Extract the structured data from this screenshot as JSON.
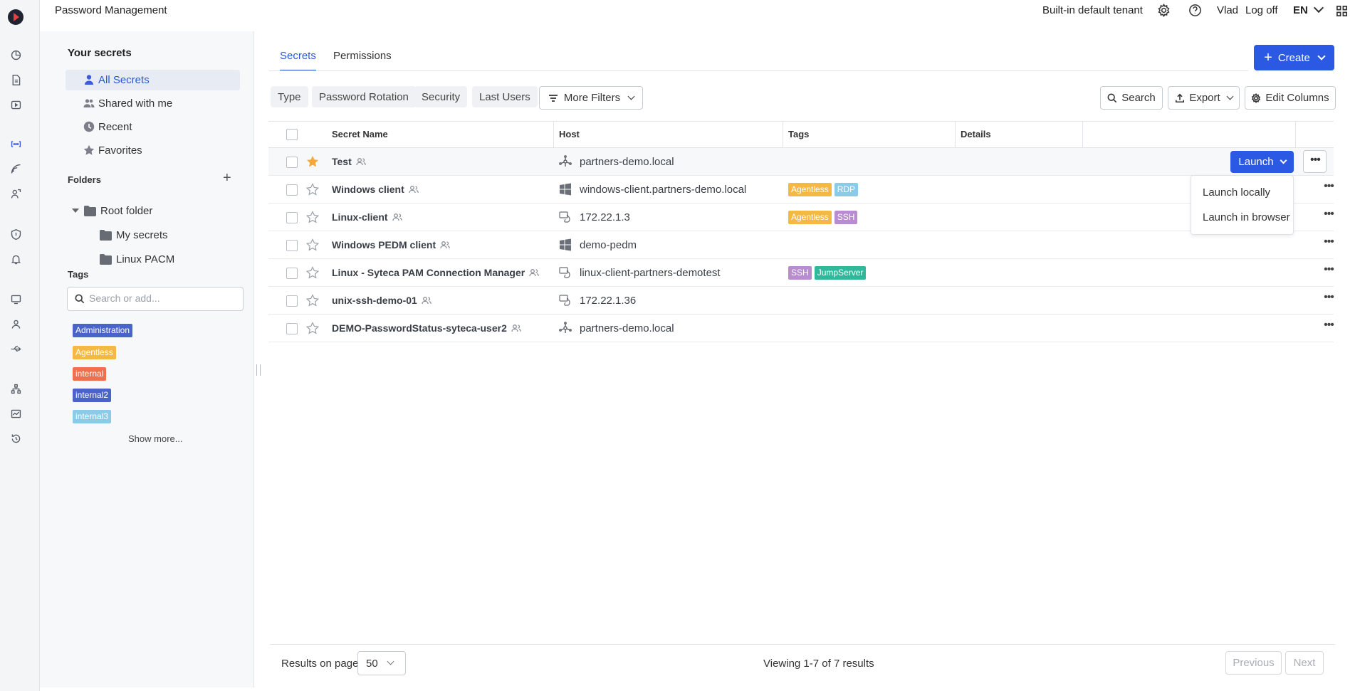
{
  "app": {
    "title": "Password Management"
  },
  "topbar": {
    "tenant": "Built-in default tenant",
    "user": "Vlad",
    "logoff": "Log off",
    "language": "EN"
  },
  "sidebar": {
    "section_title": "Your secrets",
    "items": [
      {
        "label": "All Secrets",
        "icon": "user-icon",
        "active": true
      },
      {
        "label": "Shared with me",
        "icon": "users-icon"
      },
      {
        "label": "Recent",
        "icon": "clock-icon"
      },
      {
        "label": "Favorites",
        "icon": "star-icon"
      }
    ],
    "folders_title": "Folders",
    "root_folder": "Root folder",
    "subfolders": [
      "My secrets",
      "Linux PACM"
    ],
    "tags_title": "Tags",
    "tags_search_placeholder": "Search or add...",
    "tags": [
      {
        "label": "Administration",
        "color": "#4a63c8"
      },
      {
        "label": "Agentless",
        "color": "#f4b942"
      },
      {
        "label": "internal",
        "color": "#f06f4f"
      },
      {
        "label": "internal2",
        "color": "#4a63c8"
      },
      {
        "label": "internal3",
        "color": "#8bcbe8"
      }
    ],
    "show_more": "Show more..."
  },
  "tabs": [
    {
      "label": "Secrets",
      "active": true
    },
    {
      "label": "Permissions"
    }
  ],
  "toolbar": {
    "create": "Create",
    "filters": [
      "Type",
      "Password Rotation",
      "Security",
      "Last Users"
    ],
    "more_filters": "More Filters",
    "search": "Search",
    "export": "Export",
    "edit_columns": "Edit Columns"
  },
  "table": {
    "columns": [
      "Secret Name",
      "Host",
      "Tags",
      "Details"
    ],
    "rows": [
      {
        "name": "Test",
        "favorite": true,
        "host_icon": "network-icon",
        "host": "partners-demo.local",
        "tags": []
      },
      {
        "name": "Windows client",
        "favorite": false,
        "host_icon": "windows-icon",
        "host": "windows-client.partners-demo.local",
        "tags": [
          {
            "label": "Agentless",
            "color": "#f4b942"
          },
          {
            "label": "RDP",
            "color": "#8bcbe8"
          }
        ]
      },
      {
        "name": "Linux-client",
        "favorite": false,
        "host_icon": "linux-icon",
        "host": "172.22.1.3",
        "tags": [
          {
            "label": "Agentless",
            "color": "#f4b942"
          },
          {
            "label": "SSH",
            "color": "#b98bd1"
          }
        ]
      },
      {
        "name": "Windows PEDM client",
        "favorite": false,
        "host_icon": "windows-icon",
        "host": "demo-pedm",
        "tags": []
      },
      {
        "name": "Linux - Syteca PAM Connection Manager",
        "favorite": false,
        "host_icon": "linux-icon",
        "host": "linux-client-partners-demotest",
        "tags": [
          {
            "label": "SSH",
            "color": "#b98bd1"
          },
          {
            "label": "JumpServer",
            "color": "#2fb99a"
          }
        ]
      },
      {
        "name": "unix-ssh-demo-01",
        "favorite": false,
        "host_icon": "linux-icon",
        "host": "172.22.1.36",
        "tags": []
      },
      {
        "name": "DEMO-PasswordStatus-syteca-user2",
        "favorite": false,
        "host_icon": "network-icon",
        "host": "partners-demo.local",
        "tags": []
      }
    ],
    "launch_button": "Launch",
    "launch_menu": [
      "Launch locally",
      "Launch in browser"
    ]
  },
  "footer": {
    "results_label": "Results on page",
    "page_size": "50",
    "viewing": "Viewing 1-7 of 7 results",
    "previous": "Previous",
    "next": "Next"
  }
}
